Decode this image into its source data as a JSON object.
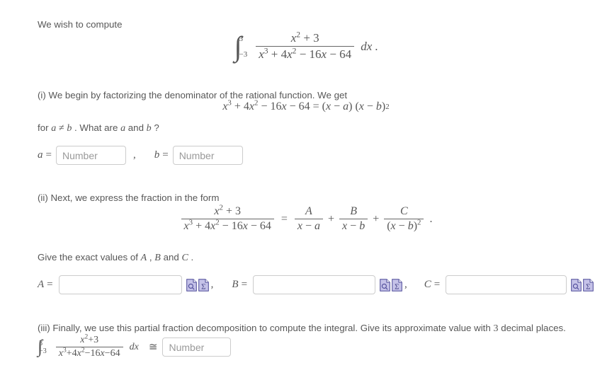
{
  "intro": {
    "text": "We wish to compute"
  },
  "integral_main": {
    "lower": "−3",
    "upper": "3",
    "numerator_base": "x",
    "numerator_pow": "2",
    "numerator_rest": "+ 3",
    "denominator": "x3 + 4x2 − 16x − 64",
    "differential": "dx",
    "trailing": "."
  },
  "part_i": {
    "text": "(i) We begin by factorizing the denominator of the rational function. We get",
    "equation": "x3 + 4x2 − 16x − 64 = (x − a) (x − b)2",
    "condition_prefix": "for",
    "condition_a": "a",
    "condition_neq": "≠",
    "condition_b": "b",
    "condition_mid": ". What are",
    "condition_a2": "a",
    "condition_and": "and",
    "condition_b2": "b",
    "condition_q": "?",
    "label_a": "a",
    "label_b": "b",
    "equals": "=",
    "comma": ",",
    "placeholder": "Number",
    "value_a": "",
    "value_b": ""
  },
  "part_ii": {
    "text": "(ii) Next, we express the fraction in the form",
    "equation": "(x^2+3)/(x^3+4x^2-16x-64) = A/(x-a) + B/(x-b) + C/(x-b)^2 .",
    "exact_text_pre": "Give the exact values of",
    "var_A": "A",
    "comma1": ",",
    "var_B": "B",
    "and": "and",
    "var_C": "C",
    "period": ".",
    "equals": "=",
    "comma_sep": ",",
    "value_A": "",
    "value_B": "",
    "value_C": "",
    "icon_preview": "document-magnifier-icon",
    "icon_sigma": "document-sigma-icon",
    "sigma_glyph": "Σ"
  },
  "part_iii": {
    "text_pre": "(iii) Finally, we use this partial fraction decomposition to compute the integral. Give its approximate value with",
    "decimals": "3",
    "text_post": "decimal places.",
    "lower": "−3",
    "upper": "3",
    "numerator": "x2+3",
    "denominator": "x3+4x2−16x−64",
    "differential": "dx",
    "approx": "≅",
    "placeholder": "Number",
    "value": ""
  },
  "colors": {
    "text": "#575757",
    "field_border": "#cccccc",
    "placeholder": "#9a9a9a",
    "icon_fill": "#c5c2e8",
    "icon_stroke": "#4b4897",
    "background": "#ffffff"
  }
}
